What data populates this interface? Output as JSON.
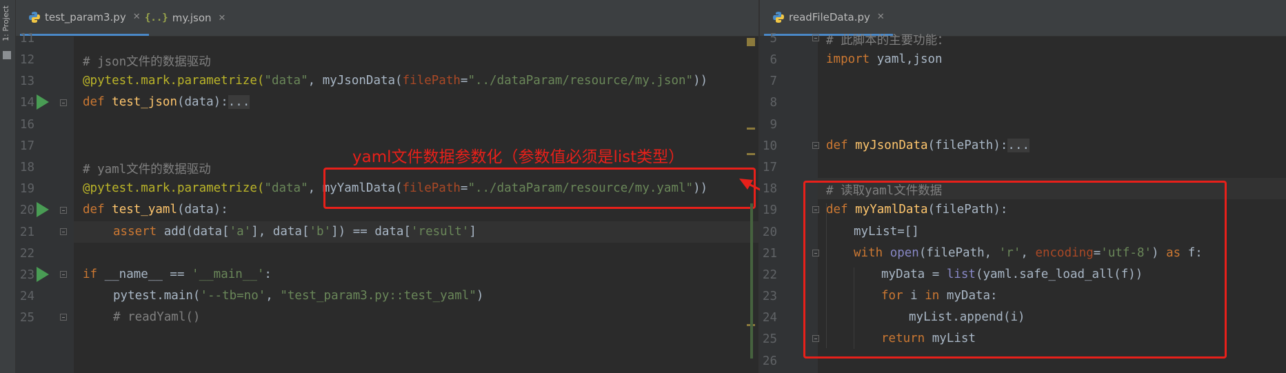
{
  "sidebar": {
    "project_label": "1: Project"
  },
  "left_tabs": [
    {
      "label": "test_param3.py",
      "icon": "python-icon",
      "active": true
    },
    {
      "label": "my.json",
      "icon": "json-icon",
      "active": false
    }
  ],
  "right_tabs": [
    {
      "label": "readFileData.py",
      "icon": "python-icon",
      "active": true
    }
  ],
  "left_lines": [
    {
      "num": "11"
    },
    {
      "num": "12"
    },
    {
      "num": "13"
    },
    {
      "num": "14"
    },
    {
      "num": "16"
    },
    {
      "num": "17"
    },
    {
      "num": "18"
    },
    {
      "num": "19"
    },
    {
      "num": "20"
    },
    {
      "num": "21"
    },
    {
      "num": "22"
    },
    {
      "num": "23"
    },
    {
      "num": "24"
    },
    {
      "num": "25"
    }
  ],
  "left_code": {
    "l12": "# json文件的数据驱动",
    "l13_dec": "@pytest.mark.parametrize(",
    "l13_s1": "\"data\"",
    "l13_c": ", ",
    "l13_fn": "myJsonData(",
    "l13_p": "filePath",
    "l13_eq": "=",
    "l13_s2": "\"../dataParam/resource/my.json\"",
    "l13_end": "))",
    "l14_kw": "def ",
    "l14_fn": "test_json",
    "l14_args": "(data):",
    "l14_dots": "...",
    "l18": "# yaml文件的数据驱动",
    "l19_dec": "@pytest.mark.parametrize(",
    "l19_s1": "\"data\"",
    "l19_c": ", ",
    "l19_fn": "myYamlData(",
    "l19_p": "filePath",
    "l19_eq": "=",
    "l19_s2": "\"../dataParam/resource/my.yaml\"",
    "l19_end": "))",
    "l20_kw": "def ",
    "l20_fn": "test_yaml",
    "l20_args": "(data):",
    "l21_kw": "assert ",
    "l21_a": "add(data[",
    "l21_s1": "'a'",
    "l21_b": "], data[",
    "l21_s2": "'b'",
    "l21_c": "]) == data[",
    "l21_s3": "'result'",
    "l21_d": "]",
    "l23_kw": "if ",
    "l23_a": "__name__ == ",
    "l23_s": "'__main__'",
    "l23_b": ":",
    "l24_a": "pytest.main(",
    "l24_s1": "'--tb=no'",
    "l24_b": ", ",
    "l24_s2": "\"test_param3.py::test_yaml\"",
    "l24_c": ")",
    "l25": "# readYaml()"
  },
  "annotation": "yaml文件数据参数化（参数值必须是list类型）",
  "right_lines": [
    {
      "num": "5"
    },
    {
      "num": "6"
    },
    {
      "num": "7"
    },
    {
      "num": "8"
    },
    {
      "num": "9"
    },
    {
      "num": "10"
    },
    {
      "num": "17"
    },
    {
      "num": "18"
    },
    {
      "num": "19"
    },
    {
      "num": "20"
    },
    {
      "num": "21"
    },
    {
      "num": "22"
    },
    {
      "num": "23"
    },
    {
      "num": "24"
    },
    {
      "num": "25"
    },
    {
      "num": "26"
    }
  ],
  "right_code": {
    "r5": "# 此脚本的主要功能：",
    "r6_kw": "import ",
    "r6_a": "yaml,json",
    "r10_kw": "def ",
    "r10_fn": "myJsonData",
    "r10_args": "(filePath):",
    "r10_dots": "...",
    "r18": "# 读取yaml文件数据",
    "r19_kw": "def ",
    "r19_fn": "myYamlData",
    "r19_args": "(filePath):",
    "r20": "myList=[]",
    "r21_kw": "with ",
    "r21_bi": "open",
    "r21_a": "(filePath, ",
    "r21_s1": "'r'",
    "r21_b": ", ",
    "r21_p": "encoding",
    "r21_eq": "=",
    "r21_s2": "'utf-8'",
    "r21_c": ") ",
    "r21_kw2": "as ",
    "r21_d": "f:",
    "r22_a": "myData = ",
    "r22_bi": "list",
    "r22_b": "(yaml.safe_load_all(f))",
    "r23_kw": "for ",
    "r23_a": "i ",
    "r23_kw2": "in ",
    "r23_b": "myData:",
    "r24": "myList.append(i)",
    "r25_kw": "return ",
    "r25_a": "myList"
  },
  "colors": {
    "annotation_red": "#e8201a",
    "run_green": "#499c54",
    "tab_underline": "#4a88c7"
  }
}
